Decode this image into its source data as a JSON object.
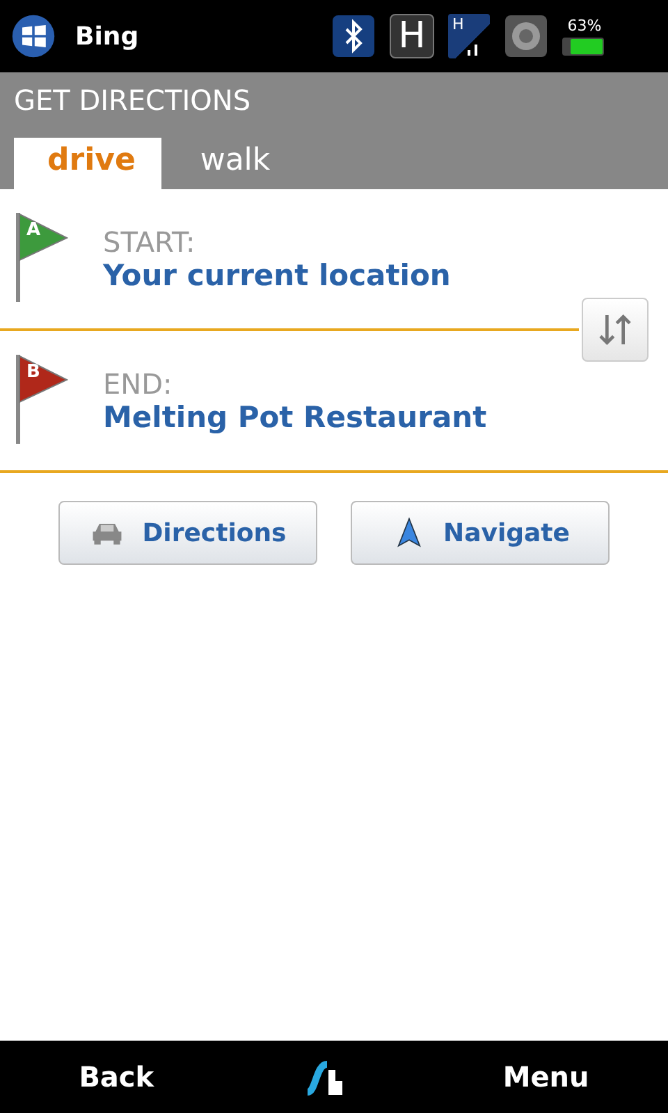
{
  "status_bar": {
    "app_name": "Bing",
    "network_badge": "H",
    "signal_badge": "H",
    "battery": "63%"
  },
  "header": {
    "title": "GET DIRECTIONS"
  },
  "tabs": [
    {
      "label": "drive",
      "selected": true
    },
    {
      "label": "walk",
      "selected": false
    }
  ],
  "route": [
    {
      "letter": "A",
      "label": "START:",
      "value": "Your current location",
      "color": "#3d9a3d"
    },
    {
      "letter": "B",
      "label": "END:",
      "value": "Melting Pot Restaurant",
      "color": "#b0281a"
    }
  ],
  "buttons": [
    {
      "kind": "car",
      "label": "Directions"
    },
    {
      "kind": "arrow",
      "label": "Navigate"
    }
  ],
  "softkeys": {
    "left": "Back",
    "right": "Menu"
  }
}
